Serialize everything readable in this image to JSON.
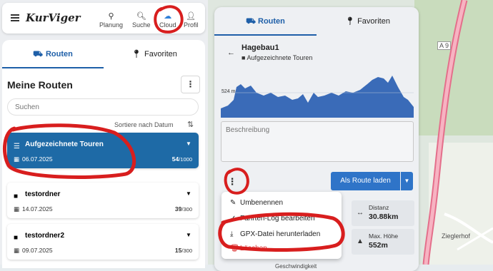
{
  "app": {
    "logo": "KurViger",
    "nav": [
      {
        "label": "Planung",
        "icon": "planning-icon"
      },
      {
        "label": "Suche",
        "icon": "search-icon"
      },
      {
        "label": "Cloud",
        "icon": "cloud-icon"
      },
      {
        "label": "Profil",
        "icon": "user-icon"
      }
    ]
  },
  "left": {
    "tabs": [
      {
        "label": "Routen",
        "icon": "route-icon"
      },
      {
        "label": "Favoriten",
        "icon": "pin-icon"
      }
    ],
    "title": "Meine Routen",
    "search_placeholder": "Suchen",
    "sort_label": "Sortiere nach Datum",
    "folders": [
      {
        "name": "Aufgezeichnete Touren",
        "date": "06.07.2025",
        "count": "54",
        "max": "/1000",
        "selected": true
      },
      {
        "name": "testordner",
        "date": "14.07.2025",
        "count": "39",
        "max": "/300",
        "selected": false
      },
      {
        "name": "testordner2",
        "date": "09.07.2025",
        "count": "15",
        "max": "/300",
        "selected": false
      }
    ]
  },
  "right": {
    "tabs": [
      {
        "label": "Routen"
      },
      {
        "label": "Favoriten"
      }
    ],
    "tour_title": "Hagebau1",
    "tour_folder": "Aufgezeichnete Touren",
    "elevation_label": "524 m",
    "description_placeholder": "Beschreibung",
    "load_button": "Als Route laden",
    "stats": [
      {
        "label": "Distanz",
        "value": "30.88km",
        "icon": "distance-icon"
      },
      {
        "label": "Max. Höhe",
        "value": "552m",
        "icon": "mountain-icon"
      }
    ],
    "footer_partial": "Geschwindigkeit",
    "context_menu": [
      {
        "label": "Umbenennen",
        "icon": "pencil-icon"
      },
      {
        "label": "Fahrten-Log bearbeiten",
        "icon": "check-icon"
      },
      {
        "label": "GPX-Datei herunterladen",
        "icon": "download-icon"
      },
      {
        "label": "Löschen",
        "icon": "trash-icon"
      }
    ]
  },
  "map": {
    "road_label": "A 9",
    "place_label": "Zieglerhof"
  },
  "colors": {
    "primary": "#1e5fa8",
    "selected_folder": "#1e6aa6",
    "button": "#2f74c8",
    "annotation": "#d81e1e",
    "highway": "#e0607e"
  }
}
